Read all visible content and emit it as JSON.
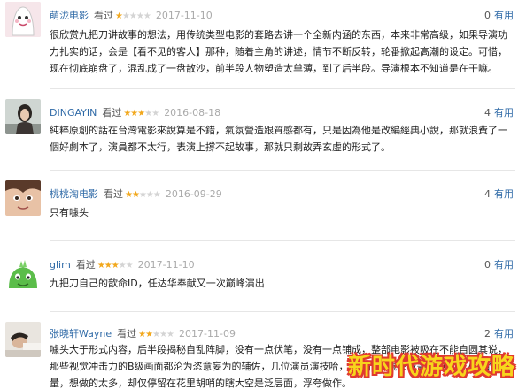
{
  "reviews": [
    {
      "username": "萌泷电影",
      "watched": "看过",
      "rating": 1,
      "date": "2017-11-10",
      "useful_count": "0",
      "useful_label": "有用",
      "text": "很欣赏九把刀讲故事的想法，用传统类型电影的套路去讲一个全新内涵的东西，本来非常高级，如果导演功力扎实的话，会是【看不见的客人】那种，随着主角的讲述，情节不断反转，轮番掀起高潮的设定。可惜，现在彻底崩盘了，混乱成了一盘散沙，前半段人物塑造太单薄，到了后半段。导演根本不知道是在干嘛。"
    },
    {
      "username": "DINGAYIN",
      "watched": "看过",
      "rating": 3,
      "date": "2016-08-18",
      "useful_count": "4",
      "useful_label": "有用",
      "text": "純粹原創的話在台灣電影來說算是不錯，氣氛營造跟質感都有，只是因為他是改編經典小說，那就浪費了一個好劇本了，演員都不太行，表演上撐不起故事，那就只剩故弄玄虛的形式了。"
    },
    {
      "username": "桃桃淘电影",
      "watched": "看过",
      "rating": 2,
      "date": "2016-09-29",
      "useful_count": "4",
      "useful_label": "有用",
      "text": "只有噱头"
    },
    {
      "username": "glim",
      "watched": "看过",
      "rating": 3,
      "date": "2017-11-10",
      "useful_count": "0",
      "useful_label": "有用",
      "text": "九把刀自己的歆命ID，任达华奉献又一次巅峰演出"
    },
    {
      "username": "张晓轩Wayne",
      "watched": "看过",
      "rating": 2,
      "date": "2017-11-09",
      "useful_count": "2",
      "useful_label": "有用",
      "text": "噱头大于形式内容，后半段揭秘自乱阵脚，没有一点伏笔，没有一点铺成，整部电影被吸在不能自圆其说，那些视觉冲击力的B级画面都沦为恣意妄为的辅佐，几位演员演技哈，脚的情色镜头覆盖掉电影对人性的思量，想做的太多，却仅停留在花里胡哨的瞎大空是泛层面，浮夸做作。"
    }
  ],
  "watermark": "新时代游戏攻略",
  "colors": {
    "username": "#2f6aa7",
    "star_on": "#f2a81d",
    "star_off": "#d4d4d4",
    "date": "#aaaaaa",
    "divider": "#e6e6e6",
    "watermark_fill": "#f7d51c",
    "watermark_stroke": "#e03a2f"
  },
  "avatars": [
    "cartoon-ghost-icon",
    "person-photo",
    "anime-face-photo",
    "green-dinosaur-icon",
    "person-lying-photo"
  ]
}
